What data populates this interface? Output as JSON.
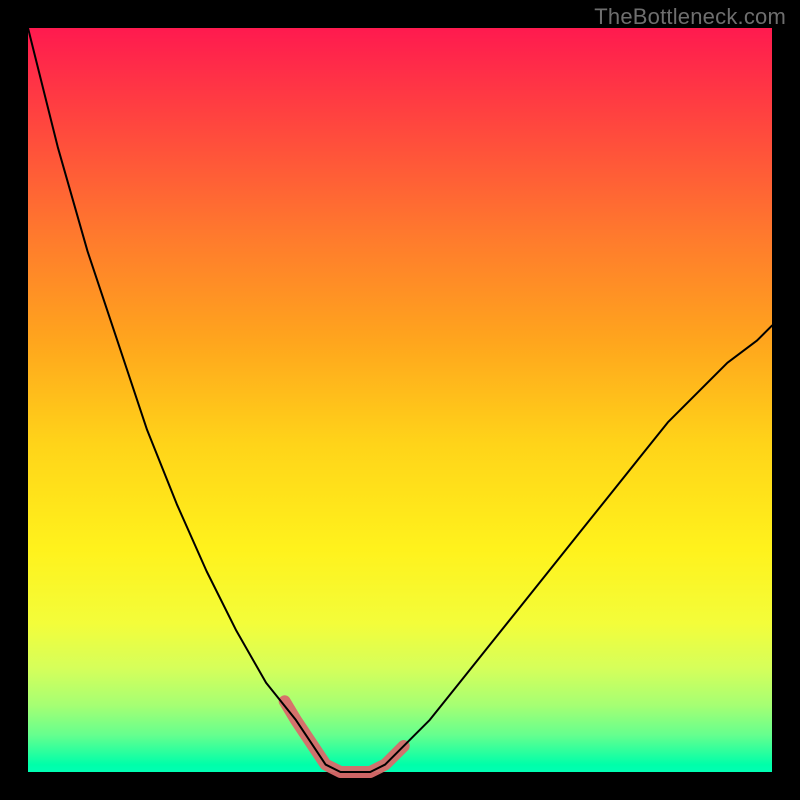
{
  "watermark": "TheBottleneck.com",
  "chart_data": {
    "type": "line",
    "title": "",
    "xlabel": "",
    "ylabel": "",
    "x": [
      0.0,
      0.04,
      0.08,
      0.12,
      0.16,
      0.2,
      0.24,
      0.28,
      0.32,
      0.36,
      0.38,
      0.4,
      0.42,
      0.44,
      0.46,
      0.48,
      0.5,
      0.54,
      0.58,
      0.62,
      0.66,
      0.7,
      0.74,
      0.78,
      0.82,
      0.86,
      0.9,
      0.94,
      0.98,
      1.0
    ],
    "values": [
      1.0,
      0.84,
      0.7,
      0.58,
      0.46,
      0.36,
      0.27,
      0.19,
      0.12,
      0.07,
      0.04,
      0.01,
      0.0,
      0.0,
      0.0,
      0.01,
      0.03,
      0.07,
      0.12,
      0.17,
      0.22,
      0.27,
      0.32,
      0.37,
      0.42,
      0.47,
      0.51,
      0.55,
      0.58,
      0.6
    ],
    "accent_x": [
      0.345,
      0.36,
      0.38,
      0.4,
      0.42,
      0.44,
      0.46,
      0.48,
      0.505
    ],
    "accent_y": [
      0.095,
      0.07,
      0.04,
      0.01,
      0.0,
      0.0,
      0.0,
      0.01,
      0.035
    ],
    "axes_visible": false,
    "xlim": [
      0,
      1
    ],
    "ylim": [
      0,
      1
    ]
  }
}
